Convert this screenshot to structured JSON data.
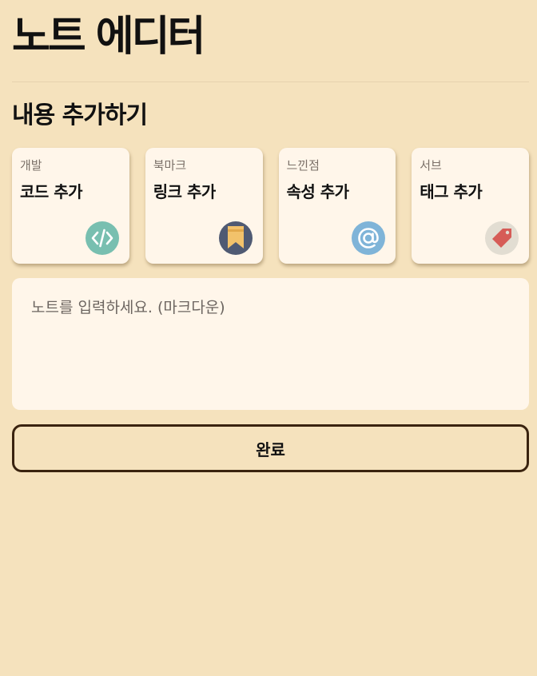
{
  "header": {
    "title": "노트 에디터"
  },
  "section": {
    "title": "내용 추가하기"
  },
  "cards": [
    {
      "category": "개발",
      "label": "코드 추가",
      "icon": "code-icon",
      "icon_bg": "#78bfb0"
    },
    {
      "category": "북마크",
      "label": "링크 추가",
      "icon": "bookmark-icon",
      "icon_bg": "#4f5a73"
    },
    {
      "category": "느낀점",
      "label": "속성 추가",
      "icon": "at-sign-icon",
      "icon_bg": "#7fb4d8"
    },
    {
      "category": "서브",
      "label": "태그 추가",
      "icon": "tag-icon",
      "icon_bg": "#e2ddd2"
    }
  ],
  "editor": {
    "placeholder": "노트를 입력하세요. (마크다운)"
  },
  "actions": {
    "done_label": "완료"
  }
}
